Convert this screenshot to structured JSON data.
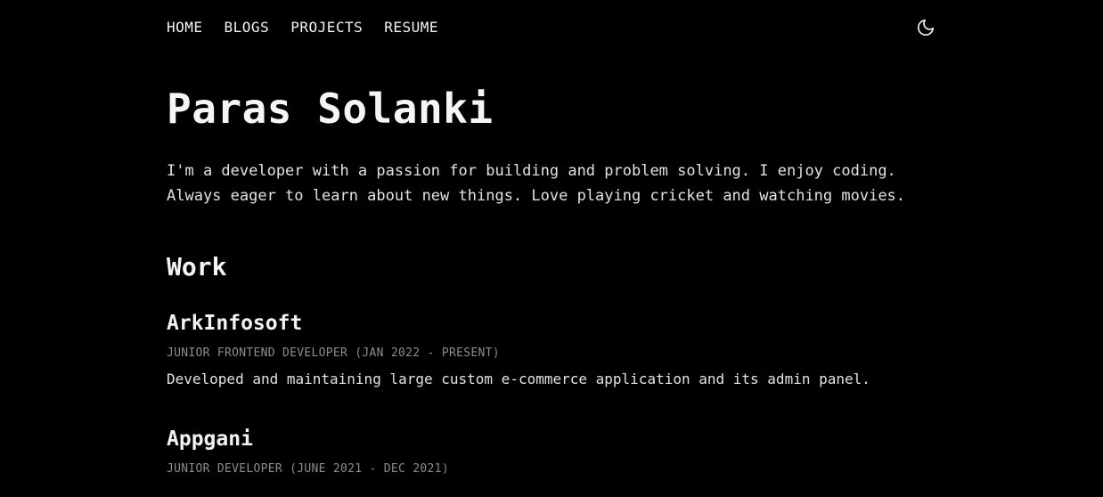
{
  "nav": {
    "items": [
      {
        "label": "HOME"
      },
      {
        "label": "BLOGS"
      },
      {
        "label": "PROJECTS"
      },
      {
        "label": "RESUME"
      }
    ],
    "theme_icon": "moon-icon"
  },
  "hero": {
    "name": "Paras Solanki",
    "bio": "I'm a developer with a passion for building and problem solving. I enjoy coding. Always eager to learn about new things. Love playing cricket and watching movies."
  },
  "work": {
    "title": "Work",
    "jobs": [
      {
        "company": "ArkInfosoft",
        "role": "JUNIOR FRONTEND DEVELOPER (JAN 2022 - PRESENT)",
        "description": "Developed and maintaining large custom e-commerce application and its admin panel."
      },
      {
        "company": "Appgani",
        "role": "JUNIOR DEVELOPER (JUNE 2021 - DEC 2021)",
        "description": ""
      }
    ]
  },
  "colors": {
    "background": "#000000",
    "text": "#ececec",
    "muted": "#8c8c8c"
  }
}
